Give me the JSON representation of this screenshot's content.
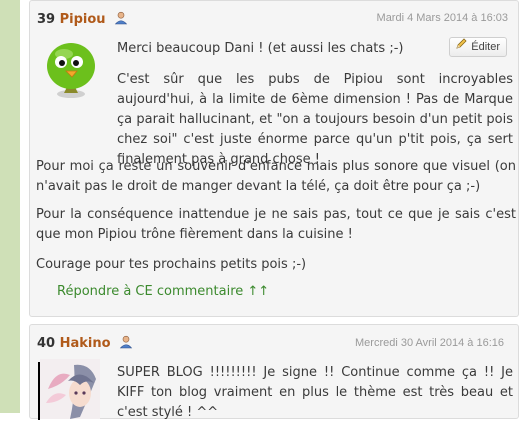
{
  "comments": [
    {
      "number": "39",
      "author": "Pipiou",
      "date": "Mardi 4 Mars 2014 à 16:03",
      "edit_label": "Éditer",
      "paragraphs": [
        "Merci beaucoup Dani ! (et aussi les chats ;-)",
        "C'est sûr que les pubs de Pipiou sont incroyables aujourd'hui, à la limite de 6ème dimension ! Pas de Marque ça parait hallucinant, et \"on a toujours besoin d'un petit pois chez soi\" c'est juste énorme parce qu'un p'tit pois, ça sert finalement pas à grand chose !",
        "Pour moi ça reste un souvenir d'enfance mais plus sonore que visuel (on n'avait pas le droit de manger devant la télé, ça doit être pour ça ;-)",
        "Pour la conséquence inattendue je ne sais pas, tout ce que je sais c'est que mon Pipiou trône fièrement dans la cuisine !",
        "Courage pour tes prochains petits pois ;-)"
      ],
      "reply_label": "Répondre à CE commentaire ↑↑"
    },
    {
      "number": "40",
      "author": "Hakino",
      "date": "Mercredi 30 Avril 2014 à 16:16",
      "paragraphs": [
        "SUPER BLOG !!!!!!!!! Je signe !! Continue comme ça !! Je KIFF ton blog vraiment en plus le thème est très beau et c'est stylé ! ^^"
      ]
    }
  ],
  "icons": {
    "user": "user-icon",
    "edit": "pencil-icon"
  },
  "colors": {
    "author": "#b05a1a",
    "reply_link": "#3c8a2e",
    "side_bar": "#cfe0b7"
  }
}
